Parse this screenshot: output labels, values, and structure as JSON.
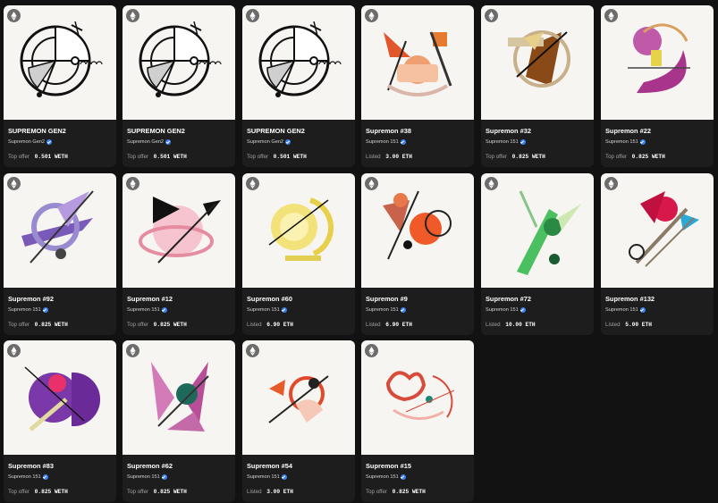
{
  "cards": [
    {
      "title": "SUPREMON GEN2",
      "collection": "Supremon Gen2",
      "price_label": "Top offer",
      "price_value": "0.501 WETH",
      "art": "gen2"
    },
    {
      "title": "SUPREMON GEN2",
      "collection": "Supremon Gen2",
      "price_label": "Top offer",
      "price_value": "0.501 WETH",
      "art": "gen2"
    },
    {
      "title": "SUPREMON GEN2",
      "collection": "Supremon Gen2",
      "price_label": "Top offer",
      "price_value": "0.501 WETH",
      "art": "gen2"
    },
    {
      "title": "Supremon #38",
      "collection": "Supremon 151",
      "price_label": "Listed",
      "price_value": "3.00 ETH",
      "art": "38"
    },
    {
      "title": "Supremon #32",
      "collection": "Supremon 151",
      "price_label": "Top offer",
      "price_value": "0.825 WETH",
      "art": "32"
    },
    {
      "title": "Supremon #22",
      "collection": "Supremon 151",
      "price_label": "Top offer",
      "price_value": "0.825 WETH",
      "art": "22"
    },
    {
      "title": "Supremon #92",
      "collection": "Supremon 151",
      "price_label": "Top offer",
      "price_value": "0.825 WETH",
      "art": "92"
    },
    {
      "title": "Supremon #12",
      "collection": "Supremon 151",
      "price_label": "Top offer",
      "price_value": "0.825 WETH",
      "art": "12"
    },
    {
      "title": "Supremon #60",
      "collection": "Supremon 151",
      "price_label": "Listed",
      "price_value": "6.90 ETH",
      "art": "60"
    },
    {
      "title": "Supremon #9",
      "collection": "Supremon 151",
      "price_label": "Listed",
      "price_value": "6.90 ETH",
      "art": "9"
    },
    {
      "title": "Supremon #72",
      "collection": "Supremon 151",
      "price_label": "Listed",
      "price_value": "10.00 ETH",
      "art": "72"
    },
    {
      "title": "Supremon #132",
      "collection": "Supremon 151",
      "price_label": "Listed",
      "price_value": "5.00 ETH",
      "art": "132"
    },
    {
      "title": "Supremon #83",
      "collection": "Supremon 151",
      "price_label": "Top offer",
      "price_value": "0.825 WETH",
      "art": "83"
    },
    {
      "title": "Supremon #62",
      "collection": "Supremon 151",
      "price_label": "Top offer",
      "price_value": "0.825 WETH",
      "art": "62"
    },
    {
      "title": "Supremon #54",
      "collection": "Supremon 151",
      "price_label": "Listed",
      "price_value": "3.00 ETH",
      "art": "54"
    },
    {
      "title": "Supremon #15",
      "collection": "Supremon 151",
      "price_label": "Top offer",
      "price_value": "0.825 WETH",
      "art": "15"
    }
  ]
}
